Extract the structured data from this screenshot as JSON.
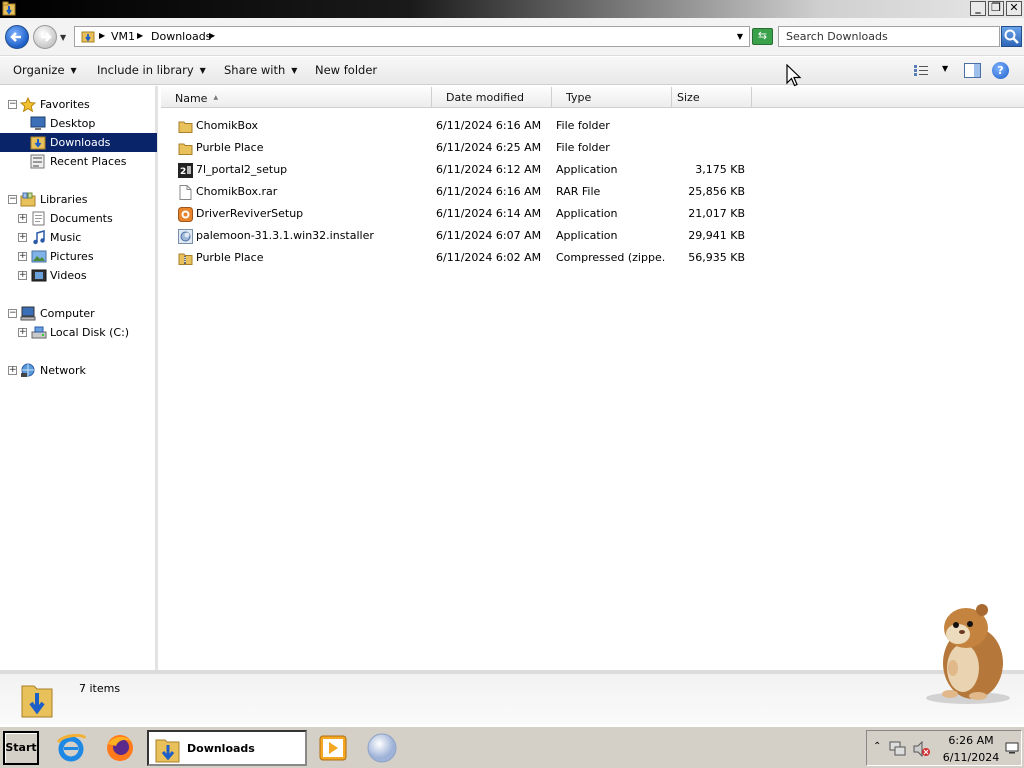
{
  "window": {
    "title": "Downloads"
  },
  "address": {
    "crumbs": [
      "VM1",
      "Downloads"
    ],
    "search_placeholder": "Search Downloads"
  },
  "toolbar": {
    "organize": "Organize",
    "include_in_library": "Include in library",
    "share_with": "Share with",
    "new_folder": "New folder"
  },
  "nav": {
    "favorites": "Favorites",
    "desktop": "Desktop",
    "downloads": "Downloads",
    "recent_places": "Recent Places",
    "libraries": "Libraries",
    "documents": "Documents",
    "music": "Music",
    "pictures": "Pictures",
    "videos": "Videos",
    "computer": "Computer",
    "local_disk": "Local Disk (C:)",
    "network": "Network"
  },
  "columns": {
    "name": "Name",
    "date": "Date modified",
    "type": "Type",
    "size": "Size"
  },
  "files": [
    {
      "name": "ChomikBox",
      "date": "6/11/2024 6:16 AM",
      "type": "File folder",
      "size": "",
      "icon": "folder-icon"
    },
    {
      "name": "Purble Place",
      "date": "6/11/2024 6:25 AM",
      "type": "File folder",
      "size": "",
      "icon": "folder-icon"
    },
    {
      "name": "7l_portal2_setup",
      "date": "6/11/2024 6:12 AM",
      "type": "Application",
      "size": "3,175 KB",
      "icon": "installer-icon"
    },
    {
      "name": "ChomikBox.rar",
      "date": "6/11/2024 6:16 AM",
      "type": "RAR File",
      "size": "25,856 KB",
      "icon": "file-icon"
    },
    {
      "name": "DriverReviverSetup",
      "date": "6/11/2024 6:14 AM",
      "type": "Application",
      "size": "21,017 KB",
      "icon": "setup-icon"
    },
    {
      "name": "palemoon-31.3.1.win32.installer",
      "date": "6/11/2024 6:07 AM",
      "type": "Application",
      "size": "29,941 KB",
      "icon": "palemoon-icon"
    },
    {
      "name": "Purble Place",
      "date": "6/11/2024 6:02 AM",
      "type": "Compressed (zippe...",
      "size": "56,935 KB",
      "icon": "zip-folder-icon"
    }
  ],
  "status": {
    "count": "7 items"
  },
  "taskbar": {
    "start": "Start",
    "active_window": "Downloads",
    "time": "6:26 AM",
    "date": "6/11/2024"
  },
  "colors": {
    "selection": "#0a246a",
    "accent": "#1d5fc8",
    "folder": "#e8c15a"
  }
}
